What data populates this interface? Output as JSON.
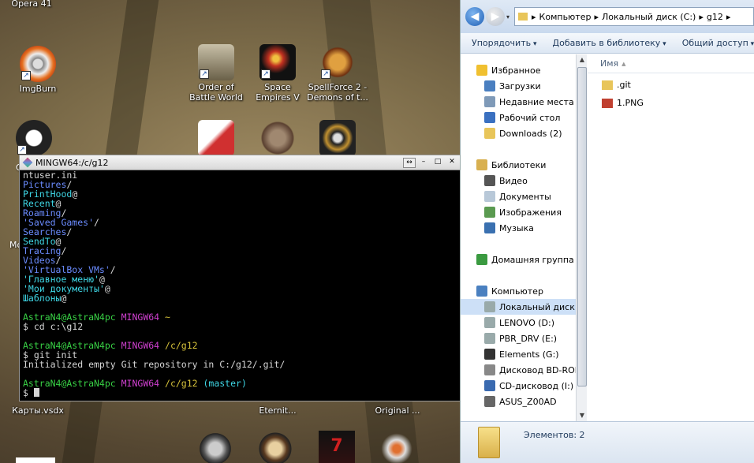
{
  "desktop": {
    "icons": [
      {
        "name": "opera-icon",
        "label": "Opera 41"
      },
      {
        "name": "imgburn-icon",
        "label": "ImgBurn"
      },
      {
        "name": "order-of-battle-icon",
        "label": "Order of Battle World War I..."
      },
      {
        "name": "space-empires-icon",
        "label": "Space Empires V"
      },
      {
        "name": "spellforce-icon",
        "label": "SpellForce 2 - Demons of t..."
      },
      {
        "name": "obs-icon",
        "label": ""
      },
      {
        "name": "cards-icon",
        "label": ""
      },
      {
        "name": "dwarf-icon",
        "label": ""
      },
      {
        "name": "warhammer-icon",
        "label": ""
      },
      {
        "name": "map-vsdx-icon",
        "label": "Карты.vsdx"
      },
      {
        "name": "eternity-icon",
        "label": "Eternit..."
      },
      {
        "name": "origin-icon",
        "label": "Original ..."
      },
      {
        "name": "left-cut-label",
        "label": "Mo"
      },
      {
        "name": "left-cut-label-2",
        "label": "O"
      }
    ],
    "bottom_icons": [
      "shield-icon",
      "gear-icon",
      "7-days-to-die-icon",
      "winged-icon"
    ]
  },
  "terminal": {
    "title": "MINGW64:/c/g12",
    "lines": [
      [
        {
          "t": "ntuser.ini",
          "c": "w"
        }
      ],
      [
        {
          "t": "Pictures",
          "c": "b"
        },
        {
          "t": "/",
          "c": "w"
        }
      ],
      [
        {
          "t": "PrintHood",
          "c": "c"
        },
        {
          "t": "@",
          "c": "w"
        }
      ],
      [
        {
          "t": "Recent",
          "c": "c"
        },
        {
          "t": "@",
          "c": "w"
        }
      ],
      [
        {
          "t": "Roaming",
          "c": "b"
        },
        {
          "t": "/",
          "c": "w"
        }
      ],
      [
        {
          "t": "'Saved Games'",
          "c": "b"
        },
        {
          "t": "/",
          "c": "w"
        }
      ],
      [
        {
          "t": "Searches",
          "c": "b"
        },
        {
          "t": "/",
          "c": "w"
        }
      ],
      [
        {
          "t": "SendTo",
          "c": "c"
        },
        {
          "t": "@",
          "c": "w"
        }
      ],
      [
        {
          "t": "Tracing",
          "c": "b"
        },
        {
          "t": "/",
          "c": "w"
        }
      ],
      [
        {
          "t": "Videos",
          "c": "b"
        },
        {
          "t": "/",
          "c": "w"
        }
      ],
      [
        {
          "t": "'VirtualBox VMs'",
          "c": "b"
        },
        {
          "t": "/",
          "c": "w"
        }
      ],
      [
        {
          "t": "'Главное меню'",
          "c": "c"
        },
        {
          "t": "@",
          "c": "w"
        }
      ],
      [
        {
          "t": "'Мои документы'",
          "c": "c"
        },
        {
          "t": "@",
          "c": "w"
        }
      ],
      [
        {
          "t": "Шаблоны",
          "c": "c"
        },
        {
          "t": "@",
          "c": "w"
        }
      ],
      [
        {
          "t": "",
          "c": "w"
        }
      ],
      [
        {
          "t": "AstraN4@AstraN4pc ",
          "c": "g"
        },
        {
          "t": "MINGW64 ",
          "c": "m"
        },
        {
          "t": "~",
          "c": "y"
        }
      ],
      [
        {
          "t": "$ cd c:\\g12",
          "c": "w"
        }
      ],
      [
        {
          "t": "",
          "c": "w"
        }
      ],
      [
        {
          "t": "AstraN4@AstraN4pc ",
          "c": "g"
        },
        {
          "t": "MINGW64 ",
          "c": "m"
        },
        {
          "t": "/c/g12",
          "c": "y"
        }
      ],
      [
        {
          "t": "$ git init",
          "c": "w"
        }
      ],
      [
        {
          "t": "Initialized empty Git repository in C:/g12/.git/",
          "c": "w"
        }
      ],
      [
        {
          "t": "",
          "c": "w"
        }
      ],
      [
        {
          "t": "AstraN4@AstraN4pc ",
          "c": "g"
        },
        {
          "t": "MINGW64 ",
          "c": "m"
        },
        {
          "t": "/c/g12 ",
          "c": "y"
        },
        {
          "t": "(master)",
          "c": "c"
        }
      ],
      [
        {
          "t": "$ ",
          "c": "w"
        }
      ]
    ]
  },
  "explorer": {
    "breadcrumb": [
      "Компьютер",
      "Локальный диск (C:)",
      "g12"
    ],
    "toolbar": {
      "organize": "Упорядочить",
      "add_to_library": "Добавить в библиотеку",
      "share": "Общий доступ"
    },
    "nav": [
      {
        "label": "Избранное",
        "icon": "star-icon",
        "level": 0,
        "color": "#f0c030"
      },
      {
        "label": "Загрузки",
        "icon": "downloads-icon",
        "level": 1,
        "color": "#4a7fc0"
      },
      {
        "label": "Недавние места",
        "icon": "recent-places-icon",
        "level": 1,
        "color": "#7f9ab8"
      },
      {
        "label": "Рабочий стол",
        "icon": "desktop-icon",
        "level": 1,
        "color": "#3a70c0"
      },
      {
        "label": "Downloads (2)",
        "icon": "folder-icon",
        "level": 1,
        "color": "#e8c55a"
      },
      {
        "label": "",
        "icon": "",
        "level": -1,
        "color": ""
      },
      {
        "label": "Библиотеки",
        "icon": "libraries-icon",
        "level": 0,
        "color": "#d8b050"
      },
      {
        "label": "Видео",
        "icon": "video-icon",
        "level": 1,
        "color": "#555"
      },
      {
        "label": "Документы",
        "icon": "documents-icon",
        "level": 1,
        "color": "#b8c8d8"
      },
      {
        "label": "Изображения",
        "icon": "images-icon",
        "level": 1,
        "color": "#5a9a50"
      },
      {
        "label": "Музыка",
        "icon": "music-icon",
        "level": 1,
        "color": "#3a70b0"
      },
      {
        "label": "",
        "icon": "",
        "level": -1,
        "color": ""
      },
      {
        "label": "Домашняя группа",
        "icon": "homegroup-icon",
        "level": 0,
        "color": "#3a9a40"
      },
      {
        "label": "",
        "icon": "",
        "level": -1,
        "color": ""
      },
      {
        "label": "Компьютер",
        "icon": "computer-icon",
        "level": 0,
        "color": "#4a80c0"
      },
      {
        "label": "Локальный диск (",
        "icon": "drive-icon",
        "level": 1,
        "color": "#9aa",
        "selected": true
      },
      {
        "label": "LENOVO (D:)",
        "icon": "drive-icon",
        "level": 1,
        "color": "#9aa"
      },
      {
        "label": "PBR_DRV (E:)",
        "icon": "drive-icon",
        "level": 1,
        "color": "#9aa"
      },
      {
        "label": "Elements (G:)",
        "icon": "elements-drive-icon",
        "level": 1,
        "color": "#333"
      },
      {
        "label": "Дисковод BD-ROM",
        "icon": "bd-rom-icon",
        "level": 1,
        "color": "#888"
      },
      {
        "label": "CD-дисковод (I:) A",
        "icon": "cd-drive-icon",
        "level": 1,
        "color": "#3a6ab0"
      },
      {
        "label": "ASUS_Z00AD",
        "icon": "phone-icon",
        "level": 1,
        "color": "#666"
      }
    ],
    "column_header": "Имя",
    "files": [
      {
        "name": ".git",
        "icon": "folder-icon",
        "color": "#e8c55a"
      },
      {
        "name": "1.PNG",
        "icon": "png-file-icon",
        "color": "#c04030"
      }
    ],
    "status": "Элементов: 2"
  }
}
